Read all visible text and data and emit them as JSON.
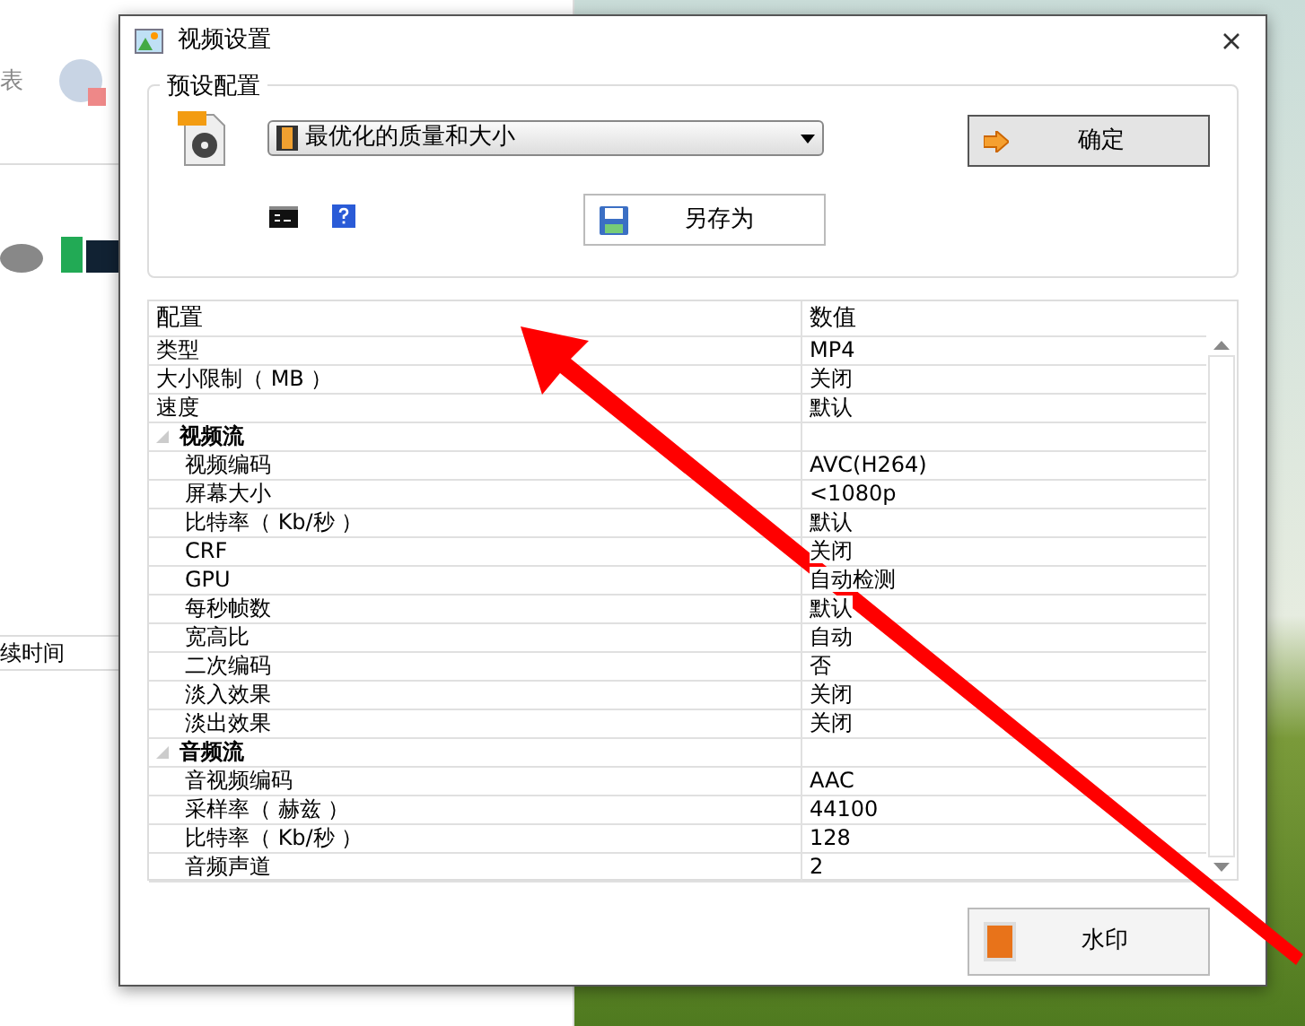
{
  "background": {
    "toolbar_label": "表",
    "column_label": "续时间"
  },
  "window": {
    "title": "视频设置"
  },
  "preset": {
    "label": "预设配置",
    "profile": "最优化的质量和大小",
    "ok_button": "确定",
    "save_as_button": "另存为"
  },
  "table": {
    "columns": [
      "配置",
      "数值"
    ],
    "rows": [
      {
        "name": "类型",
        "value": "MP4"
      },
      {
        "name": "大小限制（ MB ）",
        "value": "关闭"
      },
      {
        "name": "速度",
        "value": "默认"
      },
      {
        "name": "视频流",
        "expanded": true,
        "children": [
          {
            "name": "视频编码",
            "value": "AVC(H264)"
          },
          {
            "name": "屏幕大小",
            "value": "<1080p"
          },
          {
            "name": "比特率（ Kb/秒 ）",
            "value": "默认"
          },
          {
            "name": "CRF",
            "value": "关闭"
          },
          {
            "name": "GPU",
            "value": "自动检测"
          },
          {
            "name": "每秒帧数",
            "value": "默认"
          },
          {
            "name": "宽高比",
            "value": "自动"
          },
          {
            "name": "二次编码",
            "value": "否"
          },
          {
            "name": "淡入效果",
            "value": "关闭"
          },
          {
            "name": "淡出效果",
            "value": "关闭"
          }
        ]
      },
      {
        "name": "音频流",
        "expanded": true,
        "children": [
          {
            "name": "音视频编码",
            "value": "AAC"
          },
          {
            "name": "采样率（ 赫兹 ）",
            "value": "44100"
          },
          {
            "name": "比特率（ Kb/秒 ）",
            "value": "128"
          },
          {
            "name": "音频声道",
            "value": "2"
          }
        ]
      }
    ]
  },
  "watermark_button": "水印"
}
